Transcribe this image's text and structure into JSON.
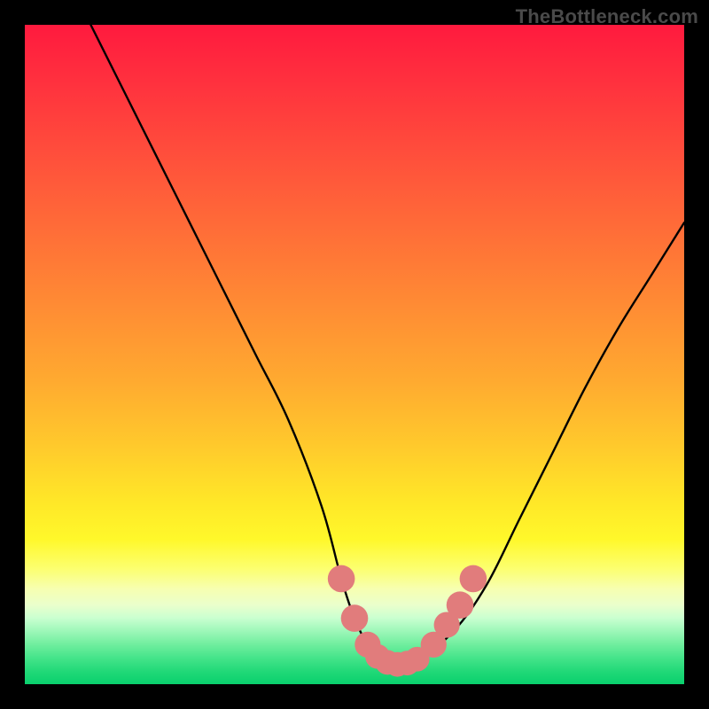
{
  "watermark": "TheBottleneck.com",
  "chart_data": {
    "type": "line",
    "title": "",
    "xlabel": "",
    "ylabel": "",
    "xlim": [
      0,
      100
    ],
    "ylim": [
      0,
      100
    ],
    "grid": false,
    "legend_position": "none",
    "series": [
      {
        "name": "bottleneck-curve",
        "color": "#000000",
        "x": [
          10,
          15,
          20,
          25,
          30,
          35,
          40,
          45,
          48,
          50,
          52,
          54,
          56,
          58,
          60,
          65,
          70,
          75,
          80,
          85,
          90,
          95,
          100
        ],
        "y": [
          100,
          90,
          80,
          70,
          60,
          50,
          40,
          27,
          16,
          10,
          6,
          4,
          3,
          3,
          4,
          8,
          15,
          25,
          35,
          45,
          54,
          62,
          70
        ]
      }
    ],
    "markers": [
      {
        "name": "left-upper-marker",
        "x": 48,
        "y": 16,
        "r": 1.6,
        "color": "#e17c7c"
      },
      {
        "name": "left-mid-marker",
        "x": 50,
        "y": 10,
        "r": 1.6,
        "color": "#e17c7c"
      },
      {
        "name": "left-low-marker",
        "x": 52,
        "y": 6,
        "r": 1.5,
        "color": "#e17c7c"
      },
      {
        "name": "trough-1-marker",
        "x": 53.5,
        "y": 4.2,
        "r": 1.4,
        "color": "#e17c7c"
      },
      {
        "name": "trough-2-marker",
        "x": 55,
        "y": 3.3,
        "r": 1.4,
        "color": "#e17c7c"
      },
      {
        "name": "trough-3-marker",
        "x": 56.5,
        "y": 3.0,
        "r": 1.4,
        "color": "#e17c7c"
      },
      {
        "name": "trough-4-marker",
        "x": 58,
        "y": 3.2,
        "r": 1.4,
        "color": "#e17c7c"
      },
      {
        "name": "trough-5-marker",
        "x": 59.5,
        "y": 3.8,
        "r": 1.4,
        "color": "#e17c7c"
      },
      {
        "name": "right-low-marker",
        "x": 62,
        "y": 6,
        "r": 1.5,
        "color": "#e17c7c"
      },
      {
        "name": "right-mid-marker",
        "x": 64,
        "y": 9,
        "r": 1.5,
        "color": "#e17c7c"
      },
      {
        "name": "right-upper-marker",
        "x": 66,
        "y": 12,
        "r": 1.6,
        "color": "#e17c7c"
      },
      {
        "name": "right-top-marker",
        "x": 68,
        "y": 16,
        "r": 1.6,
        "color": "#e17c7c"
      }
    ],
    "background_gradient": {
      "top_color": "#ff1a3e",
      "bottom_color": "#09d06d",
      "stops": [
        "red",
        "orange",
        "yellow",
        "pale-yellow",
        "pale-green",
        "green"
      ]
    }
  }
}
